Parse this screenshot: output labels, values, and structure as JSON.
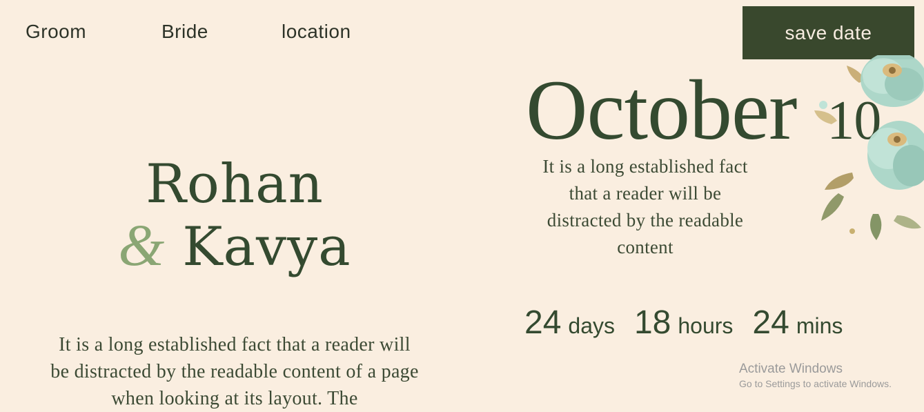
{
  "nav": {
    "groom": "Groom",
    "bride": "Bride",
    "location": "location"
  },
  "header": {
    "save_date_label": "save date"
  },
  "couple": {
    "name1": "Rohan",
    "ampersand": "&",
    "name2": "Kavya"
  },
  "intro_text": "It is a long established fact that a reader will be distracted by the readable content of a page when looking at its layout. The",
  "date": {
    "month": "October",
    "day": "10"
  },
  "date_text": "It is a long established fact that a reader will be distracted by the readable content",
  "countdown": {
    "days_value": "24",
    "days_label": "days",
    "hours_value": "18",
    "hours_label": "hours",
    "mins_value": "24",
    "mins_label": "mins"
  },
  "watermark": {
    "title": "Activate Windows",
    "subtitle": "Go to Settings to activate Windows."
  },
  "colors": {
    "background": "#faeee0",
    "primary_green": "#39482d",
    "accent_sage": "#8aa674",
    "flower_mint": "#a9d6c8"
  },
  "icons": {
    "flowers": "floral-bouquet-icon"
  }
}
